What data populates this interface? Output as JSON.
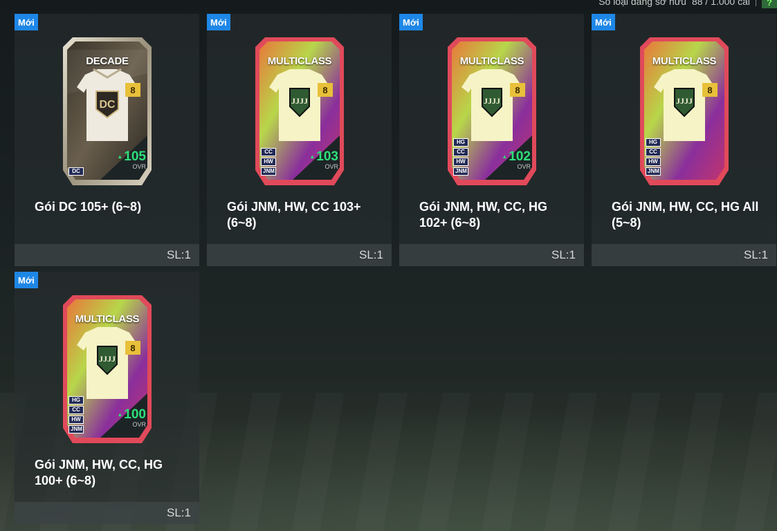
{
  "header": {
    "owned_label": "Số loại đang sở hữu",
    "owned_count": "88 / 1.000 cái",
    "help_label": "?"
  },
  "colors": {
    "badge": "#1e87e6",
    "ovr_green": "#2ee07a",
    "grade_gold": "#e8c03a",
    "tile_bg": "#282e30"
  },
  "packs": [
    {
      "badge": "Mới",
      "card_style": "decade",
      "card_label": "DECADE",
      "grade": "8",
      "ovr": "105",
      "ovr_label": "OVR",
      "tags": [
        "DC"
      ],
      "title": "Gói DC 105+ (6~8)",
      "quantity": "SL:1"
    },
    {
      "badge": "Mới",
      "card_style": "multiclass",
      "card_label": "MULTICLASS",
      "grade": "8",
      "ovr": "103",
      "ovr_label": "OVR",
      "tags": [
        "CC",
        "HW",
        "JNM"
      ],
      "title": "Gói JNM, HW, CC 103+ (6~8)",
      "quantity": "SL:1"
    },
    {
      "badge": "Mới",
      "card_style": "multiclass",
      "card_label": "MULTICLASS",
      "grade": "8",
      "ovr": "102",
      "ovr_label": "OVR",
      "tags": [
        "HG",
        "CC",
        "HW",
        "JNM"
      ],
      "title": "Gói JNM, HW, CC, HG 102+ (6~8)",
      "quantity": "SL:1"
    },
    {
      "badge": "Mới",
      "card_style": "multiclass",
      "card_label": "MULTICLASS",
      "grade": "8",
      "ovr": "",
      "ovr_label": "",
      "tags": [
        "HG",
        "CC",
        "HW",
        "JNM"
      ],
      "title": "Gói JNM, HW, CC, HG All (5~8)",
      "quantity": "SL:1"
    },
    {
      "badge": "Mới",
      "card_style": "multiclass",
      "card_label": "MULTICLASS",
      "grade": "8",
      "ovr": "100",
      "ovr_label": "OVR",
      "tags": [
        "HG",
        "CC",
        "HW",
        "JNM"
      ],
      "title": "Gói JNM, HW, CC, HG 100+ (6~8)",
      "quantity": "SL:1"
    }
  ]
}
